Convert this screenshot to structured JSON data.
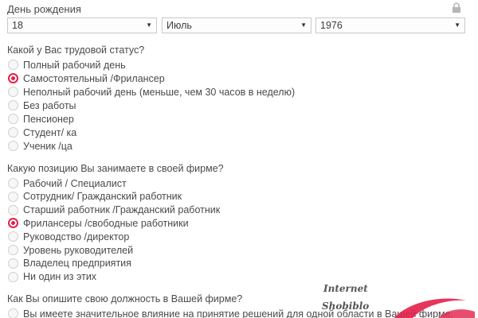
{
  "birthday": {
    "label": "День рождения",
    "day": "18",
    "month": "Июль",
    "year": "1976"
  },
  "employment": {
    "question": "Какой у Вас трудовой статус?",
    "options": [
      {
        "label": "Полный рабочий день",
        "checked": false
      },
      {
        "label": "Самостоятельный /Фрилансер",
        "checked": true
      },
      {
        "label": "Неполный рабочий день (меньше, чем 30 часов в неделю)",
        "checked": false
      },
      {
        "label": "Без работы",
        "checked": false
      },
      {
        "label": "Пенсионер",
        "checked": false
      },
      {
        "label": "Студент/ ка",
        "checked": false
      },
      {
        "label": "Ученик /ца",
        "checked": false
      }
    ]
  },
  "position": {
    "question": "Какую позицию Вы занимаете в своей фирме?",
    "options": [
      {
        "label": "Рабочий / Специалист",
        "checked": false
      },
      {
        "label": "Сотрудник/ Гражданский работник",
        "checked": false
      },
      {
        "label": "Старший работник /Гражданский работник",
        "checked": false
      },
      {
        "label": "Фрилансеры /свободные работники",
        "checked": true
      },
      {
        "label": "Руководство /директор",
        "checked": false
      },
      {
        "label": "Уровень руководителей",
        "checked": false
      },
      {
        "label": "Владелец предприятия",
        "checked": false
      },
      {
        "label": "Ни один из этих",
        "checked": false
      }
    ]
  },
  "role": {
    "question": "Как Вы опишите свою должность в Вашей фирме?",
    "options": [
      {
        "label": "Вы имеете значительное влияние на принятие решений для одной области в Вашей фирме.",
        "checked": false
      }
    ]
  },
  "watermark": {
    "line1": "Internet",
    "line2": "Shobiblo"
  },
  "colors": {
    "accent": "#e3204a"
  }
}
